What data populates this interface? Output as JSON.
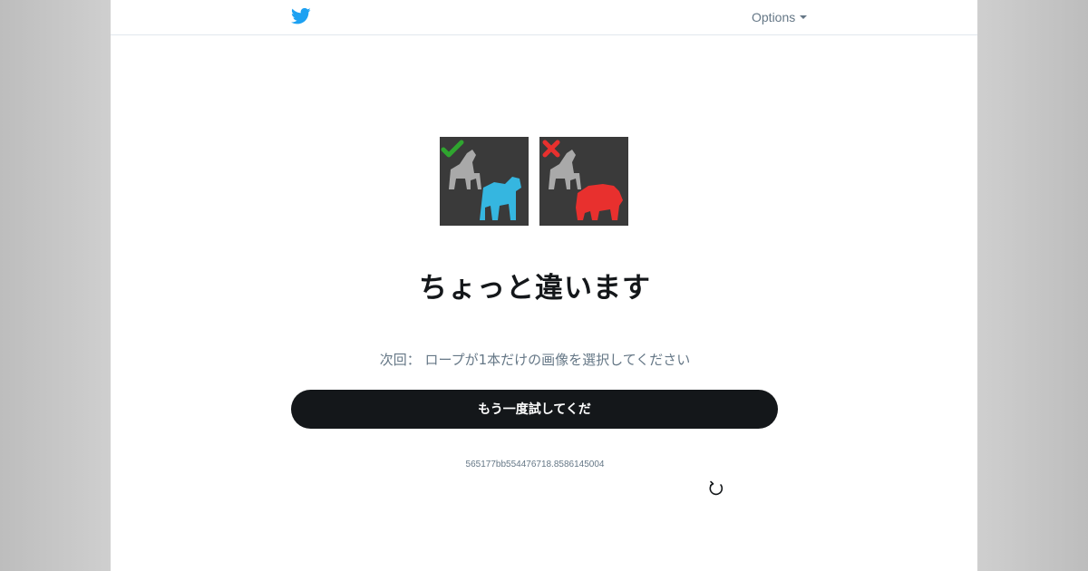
{
  "header": {
    "logo_icon": "twitter-bird-icon",
    "options_label": "Options",
    "brand_color": "#1da1f2"
  },
  "examples": {
    "correct_icon": "checkmark-icon",
    "incorrect_icon": "x-mark-icon",
    "correct_color": "#2fa52f",
    "incorrect_color": "#e8302e"
  },
  "main": {
    "title": "ちょっと違います",
    "next_instruction": "次回： ロープが1本だけの画像を選択してください",
    "retry_label": "もう一度試してくだ",
    "session_id": "565177bb554476718.8586145004",
    "reload_icon": "reload-icon"
  }
}
